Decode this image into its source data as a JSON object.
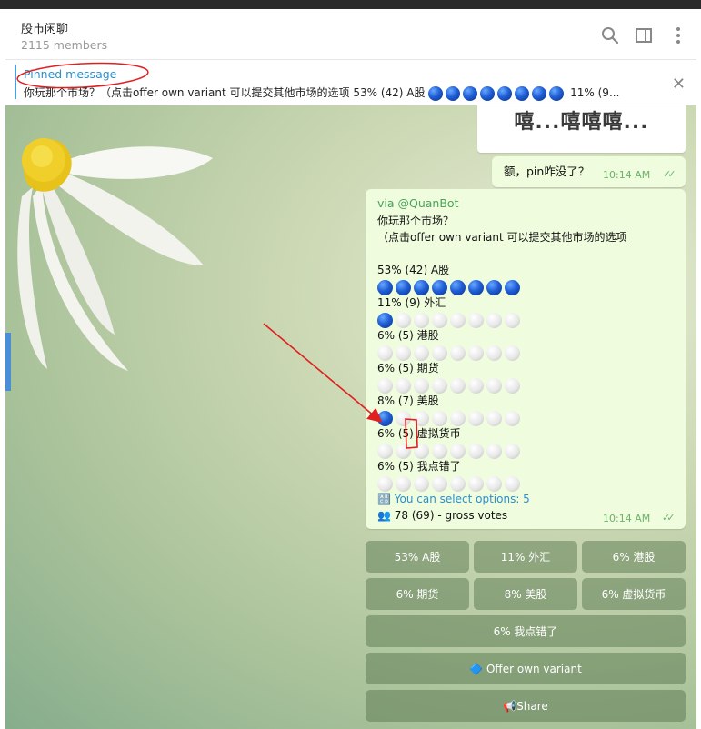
{
  "header": {
    "title": "股市闲聊",
    "members": "2115 members"
  },
  "pinned": {
    "label": "Pinned message",
    "text": "你玩那个市场？（点击offer own variant 可以提交其他市场的选项  53% (42) A股",
    "tail": "11% (9..."
  },
  "messages": {
    "image_caption": "嘻...嘻嘻嘻...",
    "out_text": "额，pin咋没了？",
    "out_time": "10:14 AM",
    "poll": {
      "via": "via @QuanBot",
      "question1": "你玩那个市场？",
      "question2": "（点击offer own variant 可以提交其他市场的选项",
      "options": [
        {
          "label": "53% (42) A股",
          "filled": 8
        },
        {
          "label": "11% (9) 外汇",
          "filled": 1
        },
        {
          "label": "6% (5) 港股",
          "filled": 0
        },
        {
          "label": "6% (5) 期货",
          "filled": 0
        },
        {
          "label": "8% (7) 美股",
          "filled": 1
        },
        {
          "label": "6% (5) 虚拟货币",
          "filled": 0
        },
        {
          "label": "6% (5) 我点错了",
          "filled": 0
        }
      ],
      "select_icon": "🔠",
      "select_text": "You can select options: 5",
      "votes_icon": "👥",
      "votes_text": "78 (69) - gross votes",
      "time": "10:14 AM"
    }
  },
  "buttons": {
    "row1": [
      "53% A股",
      "11% 外汇",
      "6% 港股"
    ],
    "row2": [
      "6% 期货",
      "8% 美股",
      "6% 虚拟货币"
    ],
    "wrong": "6% 我点错了",
    "offer": "🔷 Offer own variant",
    "share": "📢Share"
  },
  "colors": {
    "accent": "#2b8fce",
    "bubble": "#effdde",
    "annotation": "#e02020"
  }
}
